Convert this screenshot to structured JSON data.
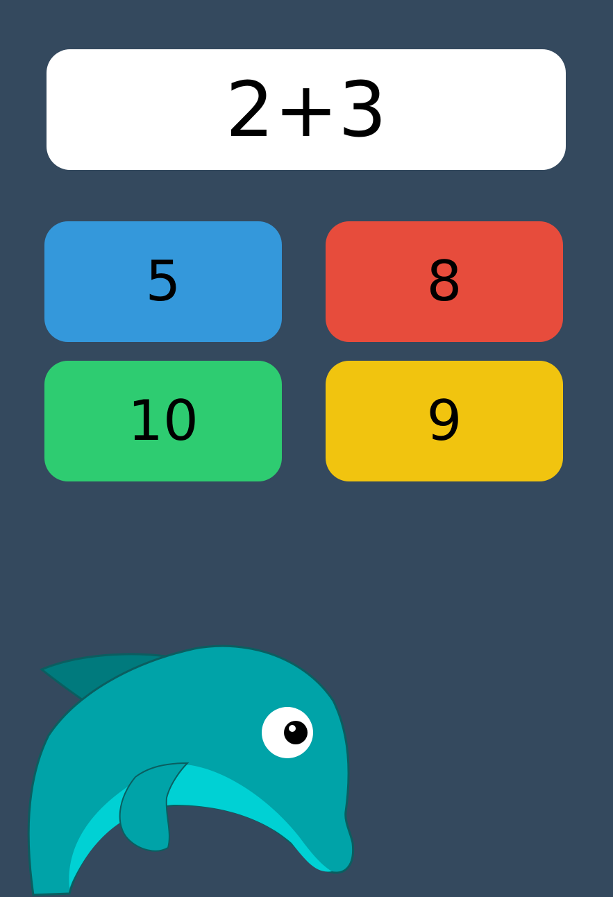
{
  "question": {
    "text": "2+3"
  },
  "answers": [
    {
      "label": "5",
      "color": "#3498db"
    },
    {
      "label": "8",
      "color": "#e74c3c"
    },
    {
      "label": "10",
      "color": "#2ecc71"
    },
    {
      "label": "9",
      "color": "#f1c40f"
    }
  ],
  "mascot": {
    "icon": "dolphin-icon",
    "body_color": "#00a3a8",
    "belly_color": "#00d1d4",
    "fin_color": "#007a7d"
  },
  "theme": {
    "background": "#34495e",
    "card": "#ffffff"
  }
}
